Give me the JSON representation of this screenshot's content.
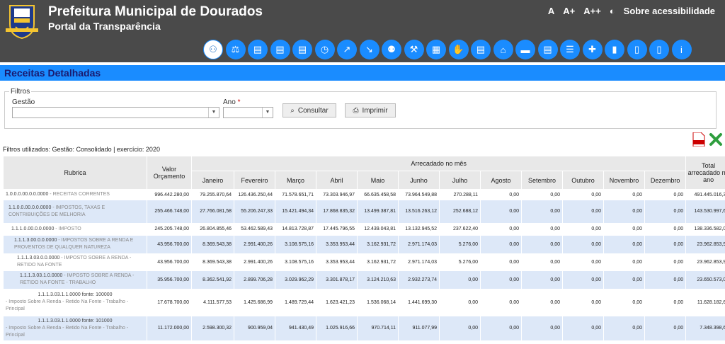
{
  "header": {
    "title": "Prefeitura Municipal de Dourados",
    "subtitle": "Portal da Transparência",
    "accessibility": {
      "a": "A",
      "a_plus": "A+",
      "a_plus_plus": "A++",
      "contrast_icon": "◐",
      "about": "Sobre acessibilidade"
    }
  },
  "nav_icons": [
    "people-icon",
    "scale-icon",
    "document-icon",
    "document-icon",
    "document-icon",
    "alarm-clock-icon",
    "line-chart-icon",
    "down-chart-icon",
    "group-icon",
    "gavel-icon",
    "building-icon",
    "handshake-icon",
    "document-icon",
    "house-icon",
    "car-icon",
    "document-icon",
    "list-icon",
    "puzzle-icon",
    "bar-chart-icon",
    "file-icon",
    "file-icon",
    "info-icon"
  ],
  "page_title": "Receitas Detalhadas",
  "filters": {
    "legend": "Filtros",
    "gestao_label": "Gestão",
    "ano_label": "Ano",
    "required": "*",
    "consultar": "Consultar",
    "imprimir": "Imprimir"
  },
  "filters_used": "Filtros utilizados: Gestão: Consolidado | exercício: 2020",
  "table": {
    "col_rubrica": "Rubrica",
    "col_valor": "Valor Orçamento",
    "col_arrecadado": "Arrecadado no mês",
    "col_total": "Total arrecadado no ano",
    "months": [
      "Janeiro",
      "Fevereiro",
      "Março",
      "Abril",
      "Maio",
      "Junho",
      "Julho",
      "Agosto",
      "Setembro",
      "Outubro",
      "Novembro",
      "Dezembro"
    ],
    "rows": [
      {
        "code": "1.0.0.0.00.0.0.0000",
        "desc": " - RECEITAS CORRENTES",
        "valor": "996.442.280,00",
        "months": [
          "79.255.870,64",
          "126.436.250,44",
          "71.578.651,71",
          "73.303.946,97",
          "66.635.458,58",
          "73.964.549,88",
          "270.288,11",
          "0,00",
          "0,00",
          "0,00",
          "0,00",
          "0,00"
        ],
        "total": "491.445.016,33"
      },
      {
        "code": "1.1.0.0.00.0.0.0000",
        "desc": " - IMPOSTOS, TAXAS E CONTRIBUIÇÕES DE MELHORIA",
        "valor": "255.466.748,00",
        "months": [
          "27.766.081,58",
          "55.206.247,33",
          "15.421.494,34",
          "17.868.835,32",
          "13.499.387,81",
          "13.516.263,12",
          "252.688,12",
          "0,00",
          "0,00",
          "0,00",
          "0,00",
          "0,00"
        ],
        "total": "143.530.997,62"
      },
      {
        "code": "1.1.1.0.00.0.0.0000",
        "desc": " - IMPOSTO",
        "valor": "245.205.748,00",
        "months": [
          "26.804.855,46",
          "53.462.589,43",
          "14.813.728,87",
          "17.445.796,55",
          "12.439.043,81",
          "13.132.945,52",
          "237.622,40",
          "0,00",
          "0,00",
          "0,00",
          "0,00",
          "0,00"
        ],
        "total": "138.336.582,04"
      },
      {
        "code": "1.1.1.3.00.0.0.0000",
        "desc": " - IMPOSTOS SOBRE A RENDA E PROVENTOS DE QUALQUER NATUREZA",
        "valor": "43.956.700,00",
        "months": [
          "8.369.543,38",
          "2.991.400,26",
          "3.108.575,16",
          "3.353.953,44",
          "3.162.931,72",
          "2.971.174,03",
          "5.276,00",
          "0,00",
          "0,00",
          "0,00",
          "0,00",
          "0,00"
        ],
        "total": "23.962.853,99"
      },
      {
        "code": "1.1.1.3.03.0.0.0000",
        "desc": " - IMPOSTO SOBRE A RENDA - RETIDO NA FONTE",
        "valor": "43.956.700,00",
        "months": [
          "8.369.543,38",
          "2.991.400,26",
          "3.108.575,16",
          "3.353.953,44",
          "3.162.931,72",
          "2.971.174,03",
          "5.276,00",
          "0,00",
          "0,00",
          "0,00",
          "0,00",
          "0,00"
        ],
        "total": "23.962.853,99"
      },
      {
        "code": "1.1.1.3.03.1.0.0000",
        "desc": " - IMPOSTO SOBRE A RENDA - RETIDO NA FONTE - TRABALHO",
        "valor": "35.956.700,00",
        "months": [
          "8.362.541,92",
          "2.899.706,28",
          "3.029.962,29",
          "3.301.878,17",
          "3.124.210,63",
          "2.932.273,74",
          "0,00",
          "0,00",
          "0,00",
          "0,00",
          "0,00",
          "0,00"
        ],
        "total": "23.650.573,03"
      },
      {
        "code": "1.1.1.3.03.1.1.0000 fonte: 100000",
        "desc": " - Imposto Sobre A Renda - Retido Na Fonte - Trabalho - Principal",
        "valor": "17.678.700,00",
        "months": [
          "4.111.577,53",
          "1.425.686,99",
          "1.489.729,44",
          "1.623.421,23",
          "1.536.068,14",
          "1.441.699,30",
          "0,00",
          "0,00",
          "0,00",
          "0,00",
          "0,00",
          "0,00"
        ],
        "total": "11.628.182,63"
      },
      {
        "code": "1.1.1.3.03.1.1.0000 fonte: 101000",
        "desc": " - Imposto Sobre A Renda - Retido Na Fonte - Trabalho - Principal",
        "valor": "11.172.000,00",
        "months": [
          "2.598.300,32",
          "900.959,04",
          "941.430,49",
          "1.025.916,66",
          "970.714,11",
          "911.077,99",
          "0,00",
          "0,00",
          "0,00",
          "0,00",
          "0,00",
          "0,00"
        ],
        "total": "7.348.398,61"
      }
    ]
  },
  "colors": {
    "header_bg": "#4a4a4a",
    "accent": "#1a8cff",
    "row_alt": "#dde8f8"
  }
}
